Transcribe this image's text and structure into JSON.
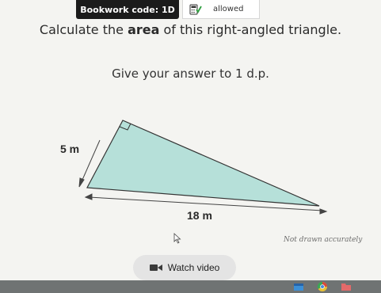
{
  "header": {
    "bookwork_label": "Bookwork code: 1D",
    "calculator_label": "allowed",
    "calculator_icon": "calculator-check-icon"
  },
  "question": {
    "title_before": "Calculate the ",
    "title_bold": "area",
    "title_after": " of this right-angled triangle.",
    "instruction": "Give your answer to 1 d.p."
  },
  "diagram": {
    "side_label_vertical": "5 m",
    "side_label_horizontal": "18 m",
    "fill_color": "#b6e0d9",
    "note": "Not drawn accurately"
  },
  "actions": {
    "watch_video_label": "Watch video",
    "video_icon": "video-camera-icon"
  },
  "taskbar": {
    "icons": [
      "taskbar-app-icon",
      "taskbar-chrome-icon",
      "taskbar-folder-icon"
    ]
  }
}
